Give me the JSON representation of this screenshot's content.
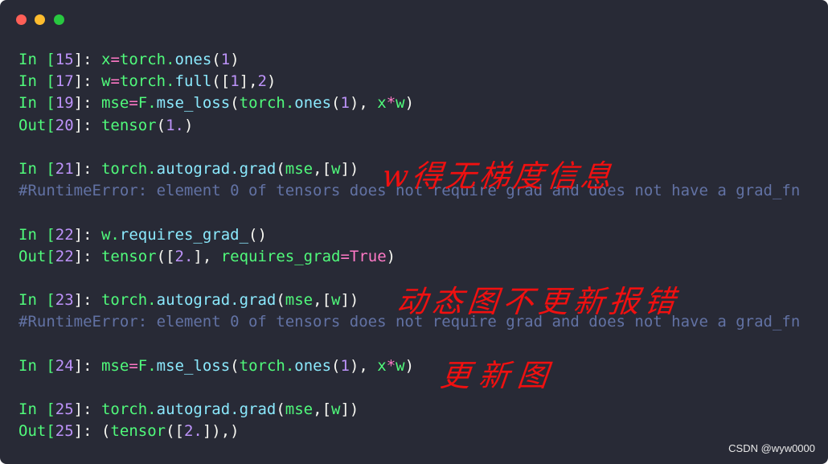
{
  "window": {
    "controls": [
      {
        "name": "close",
        "color": "#ff5f57"
      },
      {
        "name": "minimize",
        "color": "#febc2e"
      },
      {
        "name": "maximize",
        "color": "#28c840"
      }
    ]
  },
  "lines": [
    [
      [
        "In [",
        "g"
      ],
      [
        "15",
        "p"
      ],
      [
        "]: ",
        "w"
      ],
      [
        "x",
        "g"
      ],
      [
        "=",
        "k"
      ],
      [
        "torch.",
        "g"
      ],
      [
        "ones",
        "c"
      ],
      [
        "(",
        "w"
      ],
      [
        "1",
        "p"
      ],
      [
        ")",
        "w"
      ]
    ],
    [
      [
        "In [",
        "g"
      ],
      [
        "17",
        "p"
      ],
      [
        "]: ",
        "w"
      ],
      [
        "w",
        "g"
      ],
      [
        "=",
        "k"
      ],
      [
        "torch.",
        "g"
      ],
      [
        "full",
        "c"
      ],
      [
        "([",
        "w"
      ],
      [
        "1",
        "p"
      ],
      [
        "],",
        "w"
      ],
      [
        "2",
        "p"
      ],
      [
        ")",
        "w"
      ]
    ],
    [
      [
        "In [",
        "g"
      ],
      [
        "19",
        "p"
      ],
      [
        "]: ",
        "w"
      ],
      [
        "mse",
        "g"
      ],
      [
        "=",
        "k"
      ],
      [
        "F.",
        "g"
      ],
      [
        "mse_loss",
        "c"
      ],
      [
        "(",
        "w"
      ],
      [
        "torch.",
        "g"
      ],
      [
        "ones",
        "c"
      ],
      [
        "(",
        "w"
      ],
      [
        "1",
        "p"
      ],
      [
        "), ",
        "w"
      ],
      [
        "x",
        "g"
      ],
      [
        "*",
        "k"
      ],
      [
        "w",
        "g"
      ],
      [
        ")",
        "w"
      ]
    ],
    [
      [
        "Out[",
        "g"
      ],
      [
        "20",
        "p"
      ],
      [
        "]: ",
        "w"
      ],
      [
        "tensor",
        "g"
      ],
      [
        "(",
        "w"
      ],
      [
        "1.",
        "p"
      ],
      [
        ")",
        "w"
      ]
    ],
    [],
    [
      [
        "In [",
        "g"
      ],
      [
        "21",
        "p"
      ],
      [
        "]: ",
        "w"
      ],
      [
        "torch.",
        "g"
      ],
      [
        "autograd.",
        "c"
      ],
      [
        "grad",
        "c"
      ],
      [
        "(",
        "w"
      ],
      [
        "mse",
        "g"
      ],
      [
        ",[",
        "w"
      ],
      [
        "w",
        "g"
      ],
      [
        "])",
        "w"
      ]
    ],
    [
      [
        "#RuntimeError: element 0 of tensors does not require grad and does not have a grad_fn",
        "m"
      ]
    ],
    [],
    [
      [
        "In [",
        "g"
      ],
      [
        "22",
        "p"
      ],
      [
        "]: ",
        "w"
      ],
      [
        "w.",
        "g"
      ],
      [
        "requires_grad_",
        "c"
      ],
      [
        "()",
        "w"
      ]
    ],
    [
      [
        "Out[",
        "g"
      ],
      [
        "22",
        "p"
      ],
      [
        "]: ",
        "w"
      ],
      [
        "tensor",
        "g"
      ],
      [
        "([",
        "w"
      ],
      [
        "2.",
        "p"
      ],
      [
        "], ",
        "w"
      ],
      [
        "requires_grad",
        "g"
      ],
      [
        "=",
        "k"
      ],
      [
        "True",
        "k"
      ],
      [
        ")",
        "w"
      ]
    ],
    [],
    [
      [
        "In [",
        "g"
      ],
      [
        "23",
        "p"
      ],
      [
        "]: ",
        "w"
      ],
      [
        "torch.",
        "g"
      ],
      [
        "autograd.",
        "c"
      ],
      [
        "grad",
        "c"
      ],
      [
        "(",
        "w"
      ],
      [
        "mse",
        "g"
      ],
      [
        ",[",
        "w"
      ],
      [
        "w",
        "g"
      ],
      [
        "])",
        "w"
      ]
    ],
    [
      [
        "#RuntimeError: element 0 of tensors does not require grad and does not have a grad_fn",
        "m"
      ]
    ],
    [],
    [
      [
        "In [",
        "g"
      ],
      [
        "24",
        "p"
      ],
      [
        "]: ",
        "w"
      ],
      [
        "mse",
        "g"
      ],
      [
        "=",
        "k"
      ],
      [
        "F.",
        "g"
      ],
      [
        "mse_loss",
        "c"
      ],
      [
        "(",
        "w"
      ],
      [
        "torch.",
        "g"
      ],
      [
        "ones",
        "c"
      ],
      [
        "(",
        "w"
      ],
      [
        "1",
        "p"
      ],
      [
        "), ",
        "w"
      ],
      [
        "x",
        "g"
      ],
      [
        "*",
        "k"
      ],
      [
        "w",
        "g"
      ],
      [
        ")",
        "w"
      ]
    ],
    [],
    [
      [
        "In [",
        "g"
      ],
      [
        "25",
        "p"
      ],
      [
        "]: ",
        "w"
      ],
      [
        "torch.",
        "g"
      ],
      [
        "autograd.",
        "c"
      ],
      [
        "grad",
        "c"
      ],
      [
        "(",
        "w"
      ],
      [
        "mse",
        "g"
      ],
      [
        ",[",
        "w"
      ],
      [
        "w",
        "g"
      ],
      [
        "])",
        "w"
      ]
    ],
    [
      [
        "Out[",
        "g"
      ],
      [
        "25",
        "p"
      ],
      [
        "]: ",
        "w"
      ],
      [
        "(",
        "w"
      ],
      [
        "tensor",
        "g"
      ],
      [
        "([",
        "w"
      ],
      [
        "2.",
        "p"
      ],
      [
        "]),)",
        "w"
      ]
    ]
  ],
  "annotations": {
    "note1": "w得无梯度信息",
    "note2": "动态图不更新报错",
    "note3": "更新图",
    "color": "#f01010"
  },
  "watermark": "CSDN @wyw0000"
}
